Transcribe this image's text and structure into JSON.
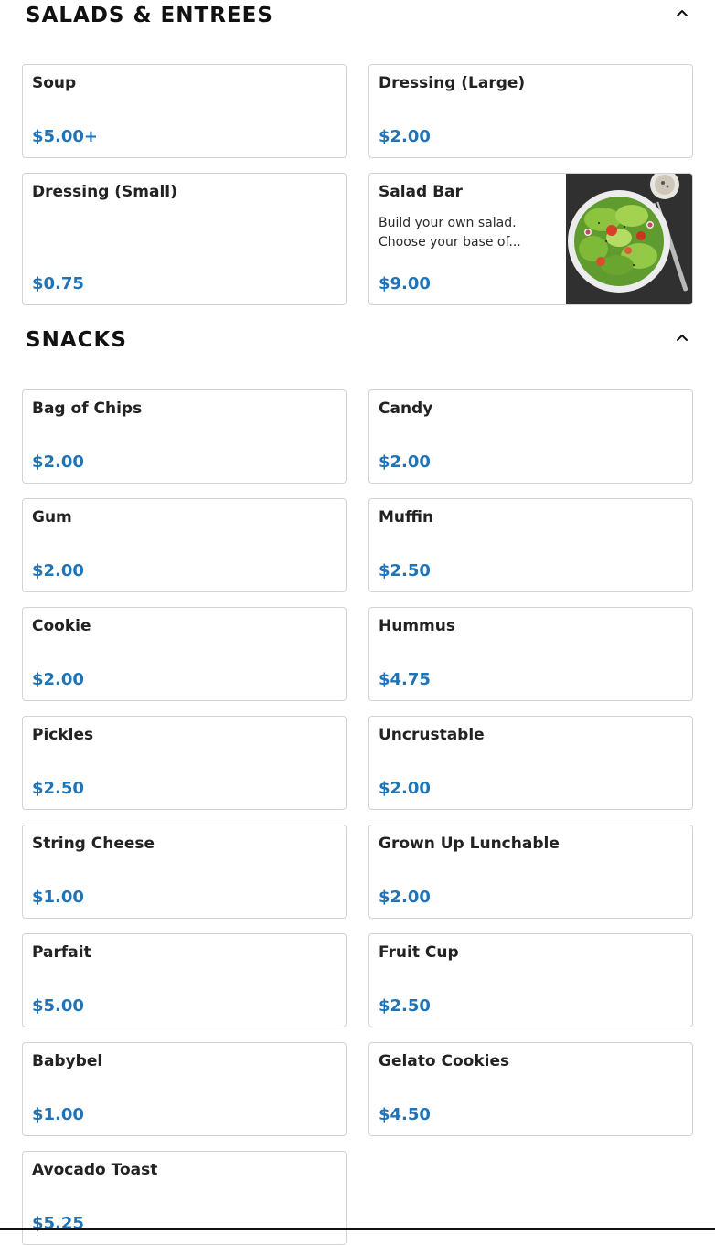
{
  "sections": [
    {
      "title": "SALADS & ENTREES",
      "items": [
        {
          "name": "Soup",
          "price": "$5.00+"
        },
        {
          "name": "Dressing (Large)",
          "price": "$2.00"
        },
        {
          "name": "Dressing (Small)",
          "price": "$0.75"
        },
        {
          "name": "Salad Bar",
          "description": "Build your own salad. Choose your base of...",
          "price": "$9.00",
          "image": "salad-bowl-image"
        }
      ]
    },
    {
      "title": "SNACKS",
      "items": [
        {
          "name": "Bag of Chips",
          "price": "$2.00"
        },
        {
          "name": "Candy",
          "price": "$2.00"
        },
        {
          "name": "Gum",
          "price": "$2.00"
        },
        {
          "name": "Muffin",
          "price": "$2.50"
        },
        {
          "name": "Cookie",
          "price": "$2.00"
        },
        {
          "name": "Hummus",
          "price": "$4.75"
        },
        {
          "name": "Pickles",
          "price": "$2.50"
        },
        {
          "name": "Uncrustable",
          "price": "$2.00"
        },
        {
          "name": "String Cheese",
          "price": "$1.00"
        },
        {
          "name": "Grown Up Lunchable",
          "price": "$2.00"
        },
        {
          "name": "Parfait",
          "price": "$5.00"
        },
        {
          "name": "Fruit Cup",
          "price": "$2.50"
        },
        {
          "name": "Babybel",
          "price": "$1.00"
        },
        {
          "name": "Gelato Cookies",
          "price": "$4.50"
        },
        {
          "name": "Avocado Toast",
          "price": "$5.25"
        }
      ]
    }
  ],
  "icons": {
    "collapse": "chevron-up-icon"
  },
  "colors": {
    "price": "#1f73b7",
    "border": "#d3d3d3",
    "text": "#222222"
  }
}
